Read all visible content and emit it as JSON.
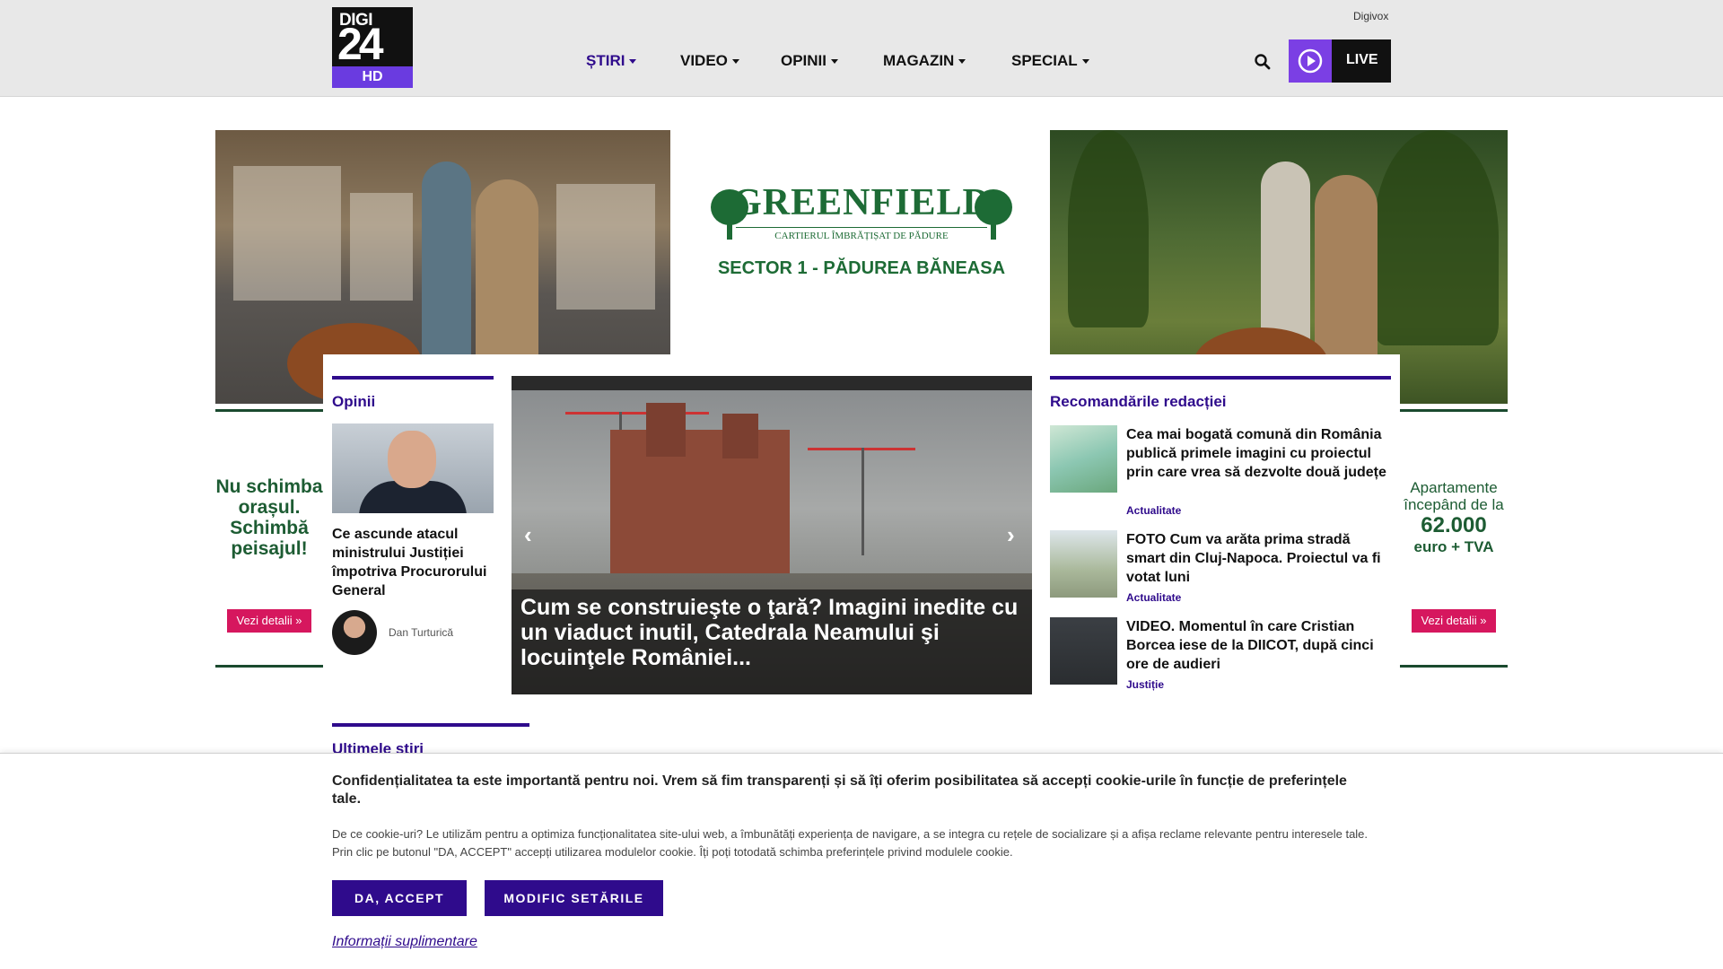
{
  "header": {
    "logo": {
      "top": "DIGI",
      "number": "24",
      "badge": "HD"
    },
    "nav": [
      {
        "label": "ȘTIRI",
        "active": true
      },
      {
        "label": "VIDEO"
      },
      {
        "label": "OPINII"
      },
      {
        "label": "MAGAZIN"
      },
      {
        "label": "SPECIAL"
      }
    ],
    "digivox": "Digivox",
    "live_label": "LIVE"
  },
  "ad": {
    "brand": "GREENFIELD",
    "tagline": "CARTIERUL ÎMBRĂȚIȘAT DE PĂDURE",
    "sector": "SECTOR 1 - PĂDUREA BĂNEASA",
    "left_slogan": [
      "Nu schimba",
      "orașul.",
      "Schimbă",
      "peisajul!"
    ],
    "right_lines": [
      "Apartamente",
      "începând de la"
    ],
    "right_price": "62.000",
    "right_suffix": "euro + TVA",
    "button": "Vezi detalii"
  },
  "opinions": {
    "title": "Opinii",
    "headline": "Ce ascunde atacul ministrului Justiției împotriva Procurorului General",
    "author": "Dan Turturică"
  },
  "slider": {
    "caption": "Cum se construieşte o ţară? Imagini inedite cu un viaduct inutil, Catedrala Neamului şi locuinţele României..."
  },
  "recommendations": {
    "title": "Recomandările redacției",
    "items": [
      {
        "title": "Cea mai bogată comună din România publică primele imagini cu proiectul prin care vrea să dezvolte două județe",
        "category": "Actualitate"
      },
      {
        "title": "FOTO Cum va arăta prima stradă smart din Cluj-Napoca. Proiectul va fi votat luni",
        "category": "Actualitate"
      },
      {
        "title": "VIDEO. Momentul în care Cristian Borcea iese de la DIICOT, după cinci ore de audieri",
        "category": "Justiție"
      }
    ]
  },
  "latest": {
    "title": "Ultimele știri"
  },
  "cookie": {
    "heading": "Confidențialitatea ta este importantă pentru noi. Vrem să fim transparenți și să îți oferim posibilitatea să accepți cookie-urile în funcție de preferințele tale.",
    "text": "De ce cookie-uri? Le utilizăm pentru a optimiza funcționalitatea site-ului web, a îmbunătăți experiența de navigare, a se integra cu rețele de socializare și a afișa reclame relevante pentru interesele tale. Prin clic pe butonul \"DA, ACCEPT\" accepți utilizarea modulelor cookie. Îți poți totodată schimba preferințele privind modulele cookie.",
    "accept": "DA, ACCEPT",
    "settings": "MODIFIC SETĂRILE",
    "more": "Informații suplimentare"
  },
  "colors": {
    "brand_purple": "#2f0b8c",
    "live_purple": "#7b3fe4",
    "ad_green": "#1d6b35",
    "ad_pink": "#d6175e"
  },
  "icons": [
    "search-icon",
    "play-icon",
    "chevron-left-icon",
    "chevron-right-icon",
    "double-chevron-right-icon",
    "caret-down-icon"
  ]
}
